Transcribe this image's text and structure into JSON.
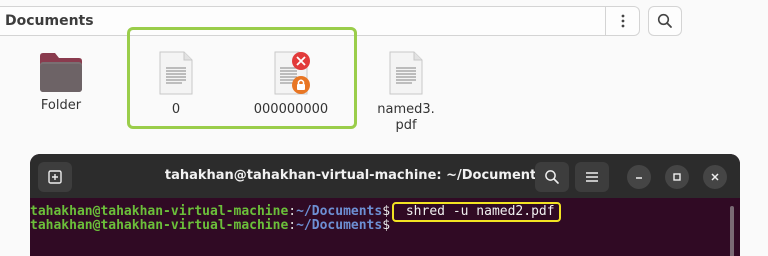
{
  "file_manager": {
    "path_title": "Documents",
    "files": [
      {
        "name": "Folder"
      },
      {
        "name": "0"
      },
      {
        "name": "000000000"
      },
      {
        "name": "named3.\npdf"
      }
    ]
  },
  "terminal": {
    "title": "tahakhan@tahakhan-virtual-machine: ~/Documents",
    "lines": [
      {
        "user": "tahakhan@tahakhan-virtual-machine",
        "colon": ":",
        "dir": "~/Documents",
        "dollar": "$",
        "command": " shred -u named2.pdf"
      },
      {
        "user": "tahakhan@tahakhan-virtual-machine",
        "colon": ":",
        "dir": "~/Documents",
        "dollar": "$",
        "command": ""
      }
    ]
  },
  "colors": {
    "highlight_green": "#9acd4a",
    "highlight_yellow": "#f2e323",
    "terminal_bg": "#300a24",
    "error_red": "#e23b3b",
    "lock_orange": "#e87624"
  }
}
